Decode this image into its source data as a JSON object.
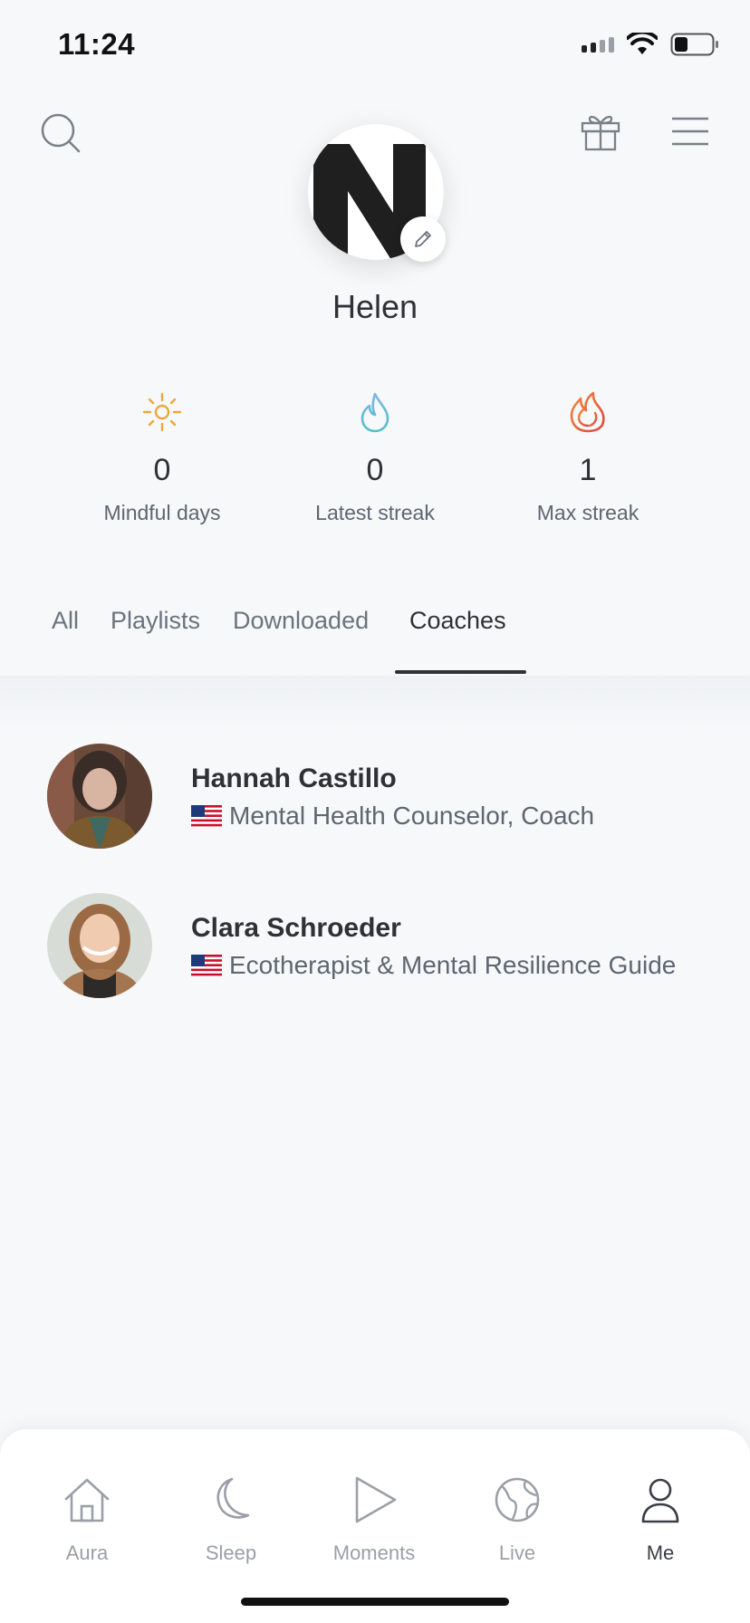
{
  "status_bar": {
    "time": "11:24",
    "battery_level": 0.3
  },
  "profile": {
    "name": "Helen",
    "avatar_letter": "N"
  },
  "stats": [
    {
      "icon": "sun-icon",
      "value": "0",
      "label": "Mindful days",
      "color": "#f0a63a"
    },
    {
      "icon": "drop-flame-icon",
      "value": "0",
      "label": "Latest streak",
      "color": "#5bb7d8"
    },
    {
      "icon": "flame-icon",
      "value": "1",
      "label": "Max streak",
      "color": "#e8603c"
    }
  ],
  "tabs": [
    {
      "label": "All"
    },
    {
      "label": "Playlists"
    },
    {
      "label": "Downloaded"
    },
    {
      "label": "Coaches",
      "active": true
    }
  ],
  "coaches": [
    {
      "name": "Hannah Castillo",
      "role": "Mental Health Counselor, Coach",
      "flag": "us-flag-icon"
    },
    {
      "name": "Clara Schroeder",
      "role": "Ecotherapist & Mental Resilience Guide",
      "flag": "us-flag-icon"
    }
  ],
  "nav": [
    {
      "label": "Aura",
      "icon": "home-icon"
    },
    {
      "label": "Sleep",
      "icon": "moon-icon"
    },
    {
      "label": "Moments",
      "icon": "play-icon"
    },
    {
      "label": "Live",
      "icon": "globe-icon"
    },
    {
      "label": "Me",
      "icon": "person-icon",
      "active": true
    }
  ]
}
